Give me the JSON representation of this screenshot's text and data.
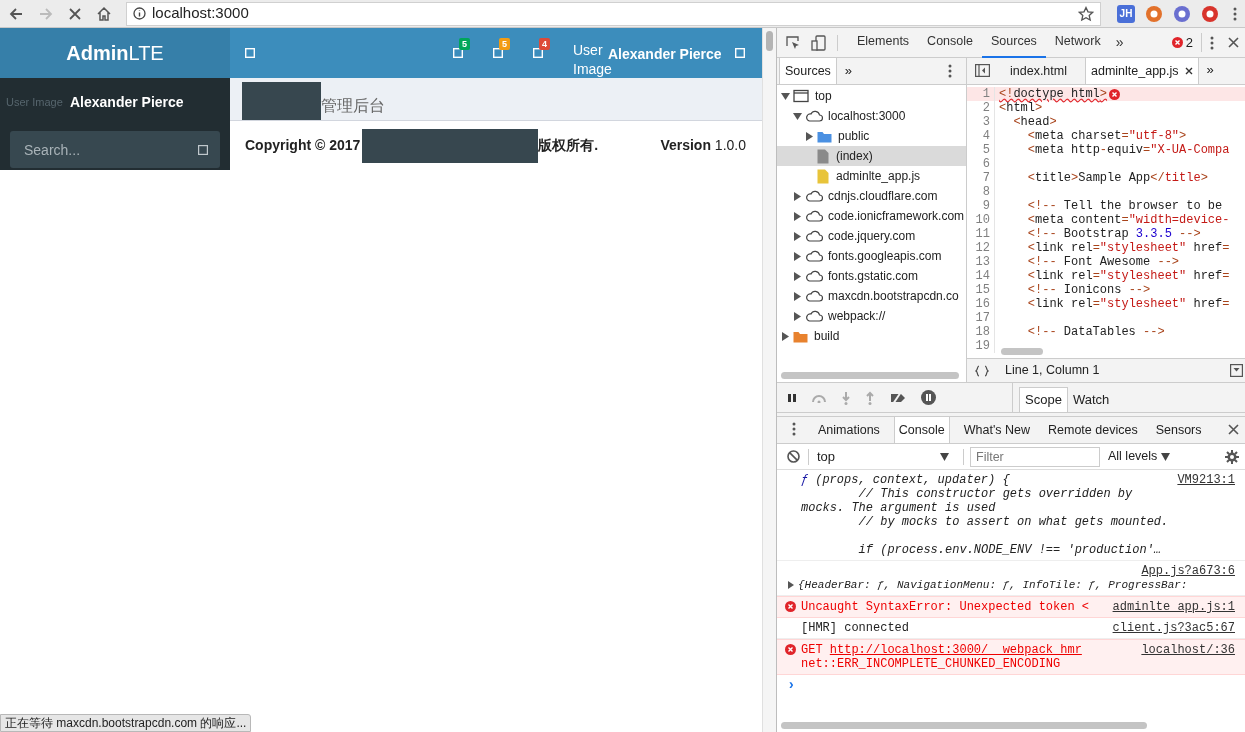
{
  "browser": {
    "url": "localhost:3000",
    "status_text": "正在等待 maxcdn.bootstrapcdn.com 的响应...",
    "extensions": [
      {
        "kind": "text",
        "label": "JH",
        "color": "#4a6fd8"
      },
      {
        "kind": "shape",
        "color": "#e2712b"
      },
      {
        "kind": "shape",
        "color": "#6a6fd0"
      },
      {
        "kind": "shape",
        "color": "#d8342c"
      }
    ]
  },
  "app": {
    "logo": "**Admin**LTE",
    "navbar": {
      "notifications": [
        {
          "count": "5",
          "color": "#00a65a"
        },
        {
          "count": "5",
          "color": "#f39c12"
        },
        {
          "count": "4",
          "color": "#dd4b39"
        }
      ],
      "user_image_alt": "User Image",
      "user_name": "Alexander Pierce"
    },
    "sidebar": {
      "user_image_alt": "User Image",
      "user_name": "Alexander Pierce",
      "search_placeholder": "Search..."
    },
    "content_header": {
      "title": "管理后台"
    },
    "footer": {
      "copyright": "Copyright © 2017",
      "rights": "版权所有.",
      "version": "**Version** 1.0.0"
    }
  },
  "devtools": {
    "tabs": [
      {
        "label": "Elements",
        "selected": false
      },
      {
        "label": "Console",
        "selected": false
      },
      {
        "label": "Sources",
        "selected": true
      },
      {
        "label": "Network",
        "selected": false
      }
    ],
    "more": "»",
    "error_count": "2",
    "navigator": {
      "tabs": [
        {
          "label": "Sources",
          "selected": true
        }
      ],
      "more": "»",
      "tree": [
        {
          "label": "top",
          "kind": "frame",
          "expanded": true,
          "selected": false,
          "children": [
            {
              "label": "localhost:3000",
              "kind": "domain",
              "expanded": true,
              "selected": false,
              "children": [
                {
                  "label": "public",
                  "kind": "folder",
                  "color": "#4a90e2",
                  "expanded": false,
                  "selected": false
                },
                {
                  "label": "(index)",
                  "kind": "file",
                  "color": "#8a8a8a",
                  "selected": true
                },
                {
                  "label": "adminlte_app.js",
                  "kind": "file",
                  "color": "#e8c43a",
                  "selected": false
                }
              ]
            },
            {
              "label": "cdnjs.cloudflare.com",
              "kind": "domain",
              "expanded": false,
              "selected": false
            },
            {
              "label": "code.ionicframework.com",
              "kind": "domain",
              "expanded": false,
              "selected": false
            },
            {
              "label": "code.jquery.com",
              "kind": "domain",
              "expanded": false,
              "selected": false
            },
            {
              "label": "fonts.googleapis.com",
              "kind": "domain",
              "expanded": false,
              "selected": false
            },
            {
              "label": "fonts.gstatic.com",
              "kind": "domain",
              "expanded": false,
              "selected": false
            },
            {
              "label": "maxcdn.bootstrapcdn.co",
              "kind": "domain",
              "expanded": false,
              "selected": false
            },
            {
              "label": "webpack://",
              "kind": "domain",
              "expanded": false,
              "selected": false
            }
          ]
        },
        {
          "label": "build",
          "kind": "folder",
          "color": "#e8822e",
          "expanded": false,
          "selected": false
        }
      ]
    },
    "editor": {
      "tabs": [
        {
          "label": "index.html",
          "selected": false,
          "closable": false
        },
        {
          "label": "adminlte_app.js",
          "selected": true,
          "closable": true
        }
      ],
      "more": "»",
      "lines": [
        {
          "number": "1",
          "error": true,
          "segments": [
            {
              "kind": "op",
              "text": "<!"
            },
            {
              "kind": "plain",
              "text": "doctype html"
            },
            {
              "kind": "op",
              "text": ">"
            }
          ]
        },
        {
          "number": "2",
          "error": false,
          "segments": [
            {
              "kind": "op",
              "text": "<"
            },
            {
              "kind": "plain",
              "text": "html"
            },
            {
              "kind": "op",
              "text": ">"
            }
          ]
        },
        {
          "number": "3",
          "error": false,
          "segments": [
            {
              "kind": "op",
              "text": "  <"
            },
            {
              "kind": "plain",
              "text": "head"
            },
            {
              "kind": "op",
              "text": ">"
            }
          ]
        },
        {
          "number": "4",
          "error": false,
          "segments": [
            {
              "kind": "op",
              "text": "    <"
            },
            {
              "kind": "plain",
              "text": "meta charset"
            },
            {
              "kind": "op",
              "text": "="
            },
            {
              "kind": "str",
              "text": "\"utf-8\""
            },
            {
              "kind": "op",
              "text": ">"
            }
          ]
        },
        {
          "number": "5",
          "error": false,
          "segments": [
            {
              "kind": "op",
              "text": "    <"
            },
            {
              "kind": "plain",
              "text": "meta http"
            },
            {
              "kind": "op",
              "text": "-"
            },
            {
              "kind": "plain",
              "text": "equiv"
            },
            {
              "kind": "op",
              "text": "="
            },
            {
              "kind": "str",
              "text": "\"X-UA-Compa"
            }
          ]
        },
        {
          "number": "6",
          "error": false
        },
        {
          "number": "7",
          "error": false,
          "segments": [
            {
              "kind": "op",
              "text": "    <"
            },
            {
              "kind": "plain",
              "text": "title"
            },
            {
              "kind": "op",
              "text": ">"
            },
            {
              "kind": "plain",
              "text": "Sample App"
            },
            {
              "kind": "op",
              "text": "</"
            },
            {
              "kind": "str",
              "text": "title"
            },
            {
              "kind": "op",
              "text": ">"
            }
          ]
        },
        {
          "number": "8",
          "error": false
        },
        {
          "number": "9",
          "error": false,
          "segments": [
            {
              "kind": "op",
              "text": "    <!--"
            },
            {
              "kind": "plain",
              "text": " Tell the browser to be"
            }
          ]
        },
        {
          "number": "10",
          "error": false,
          "segments": [
            {
              "kind": "op",
              "text": "    <"
            },
            {
              "kind": "plain",
              "text": "meta content"
            },
            {
              "kind": "op",
              "text": "="
            },
            {
              "kind": "str",
              "text": "\"width=device-"
            }
          ]
        },
        {
          "number": "11",
          "error": false,
          "segments": [
            {
              "kind": "op",
              "text": "    <!--"
            },
            {
              "kind": "plain",
              "text": " Bootstrap "
            },
            {
              "kind": "num",
              "text": "3.3.5"
            },
            {
              "kind": "op",
              "text": " -->"
            }
          ]
        },
        {
          "number": "12",
          "error": false,
          "segments": [
            {
              "kind": "op",
              "text": "    <"
            },
            {
              "kind": "plain",
              "text": "link rel"
            },
            {
              "kind": "op",
              "text": "="
            },
            {
              "kind": "str",
              "text": "\"stylesheet\""
            },
            {
              "kind": "plain",
              "text": " href"
            },
            {
              "kind": "op",
              "text": "="
            }
          ]
        },
        {
          "number": "13",
          "error": false,
          "segments": [
            {
              "kind": "op",
              "text": "    <!--"
            },
            {
              "kind": "plain",
              "text": " Font Awesome "
            },
            {
              "kind": "op",
              "text": "-->"
            }
          ]
        },
        {
          "number": "14",
          "error": false,
          "segments": [
            {
              "kind": "op",
              "text": "    <"
            },
            {
              "kind": "plain",
              "text": "link rel"
            },
            {
              "kind": "op",
              "text": "="
            },
            {
              "kind": "str",
              "text": "\"stylesheet\""
            },
            {
              "kind": "plain",
              "text": " href"
            },
            {
              "kind": "op",
              "text": "="
            }
          ]
        },
        {
          "number": "15",
          "error": false,
          "segments": [
            {
              "kind": "op",
              "text": "    <!--"
            },
            {
              "kind": "plain",
              "text": " Ionicons "
            },
            {
              "kind": "op",
              "text": "-->"
            }
          ]
        },
        {
          "number": "16",
          "error": false,
          "segments": [
            {
              "kind": "op",
              "text": "    <"
            },
            {
              "kind": "plain",
              "text": "link rel"
            },
            {
              "kind": "op",
              "text": "="
            },
            {
              "kind": "str",
              "text": "\"stylesheet\""
            },
            {
              "kind": "plain",
              "text": " href"
            },
            {
              "kind": "op",
              "text": "="
            }
          ]
        },
        {
          "number": "17",
          "error": false
        },
        {
          "number": "18",
          "error": false,
          "segments": [
            {
              "kind": "op",
              "text": "    <!--"
            },
            {
              "kind": "plain",
              "text": " DataTables "
            },
            {
              "kind": "op",
              "text": "-->"
            }
          ]
        },
        {
          "number": "19",
          "error": false
        }
      ],
      "status": "Line 1, Column 1"
    },
    "sidebar_tabs": [
      {
        "label": "Scope",
        "selected": true
      },
      {
        "label": "Watch",
        "selected": false
      }
    ],
    "drawer": {
      "tabs": [
        {
          "label": "Animations",
          "selected": false
        },
        {
          "label": "Console",
          "selected": true
        },
        {
          "label": "What's New",
          "selected": false
        },
        {
          "label": "Remote devices",
          "selected": false
        },
        {
          "label": "Sensors",
          "selected": false
        }
      ],
      "context": "top",
      "filter_placeholder": "Filter",
      "levels": "All levels",
      "messages": [
        {
          "kind": "function",
          "keyword": "ƒ",
          "text": "(props, context, updater) {\n        // This constructor gets overridden by mocks. The argument is used\n        // by mocks to assert on what gets mounted.\n\n        if (process.env.NODE_ENV !== 'production'…",
          "source": "VM9213:1"
        },
        {
          "kind": "object",
          "text": "{HeaderBar: ƒ, NavigationMenu: ƒ, InfoTile: ƒ, ProgressBar:",
          "source": "App.js?a673:6"
        },
        {
          "kind": "error",
          "text": "Uncaught SyntaxError: Unexpected token <",
          "source": "adminlte_app.js:1"
        },
        {
          "kind": "log",
          "text": "[HMR] connected",
          "source": "client.js?3ac5:67"
        },
        {
          "kind": "error",
          "text": "GET ",
          "link": "http://localhost:3000/__webpack_hmr",
          "text_after": "net::ERR_INCOMPLETE_CHUNKED_ENCODING",
          "source": "localhost/:36"
        }
      ],
      "prompt": "›"
    }
  }
}
